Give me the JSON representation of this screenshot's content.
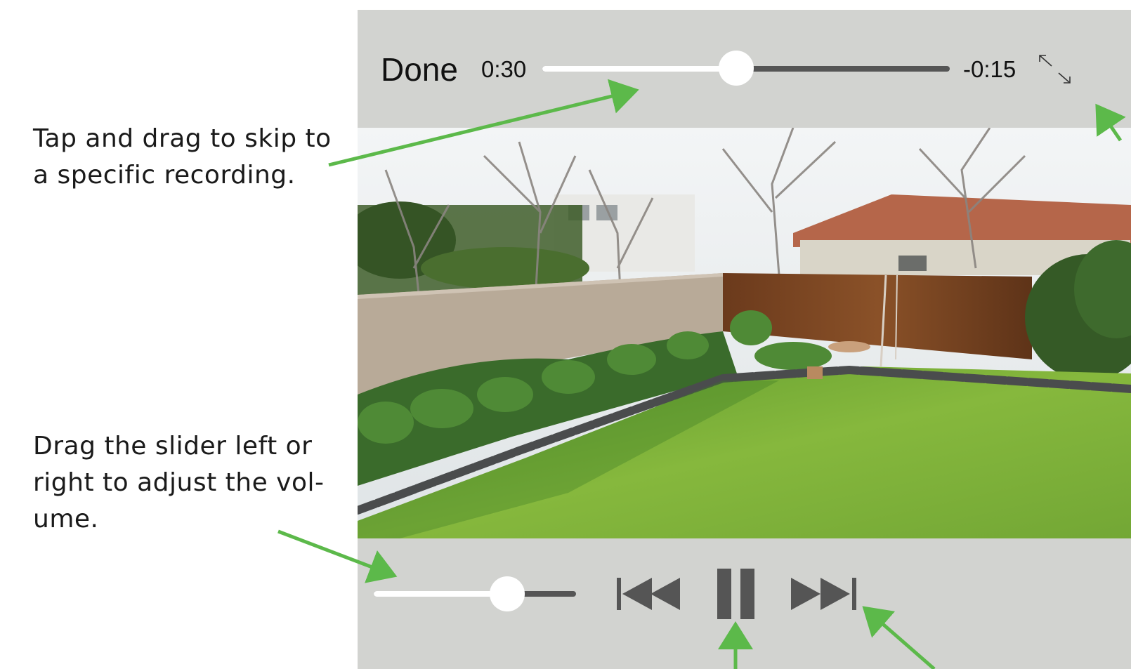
{
  "annotations": {
    "skip": "Tap and drag to skip to a specific recording.",
    "volume": "Drag the slider left or right to adjust the vol-ume."
  },
  "player": {
    "done_label": "Done",
    "time_elapsed": "0:30",
    "time_remaining": "-0:15",
    "playback_progress": 0.475,
    "volume_level": 0.66,
    "fullscreen_icon": "expand-arrows-icon",
    "previous_icon": "skip-back-icon",
    "pause_icon": "pause-icon",
    "next_icon": "skip-forward-icon"
  },
  "colors": {
    "player_background": "#d2d3d0",
    "annotation_arrow": "#5cb94a",
    "control_gray": "#555555",
    "track_fill": "#ffffff"
  }
}
